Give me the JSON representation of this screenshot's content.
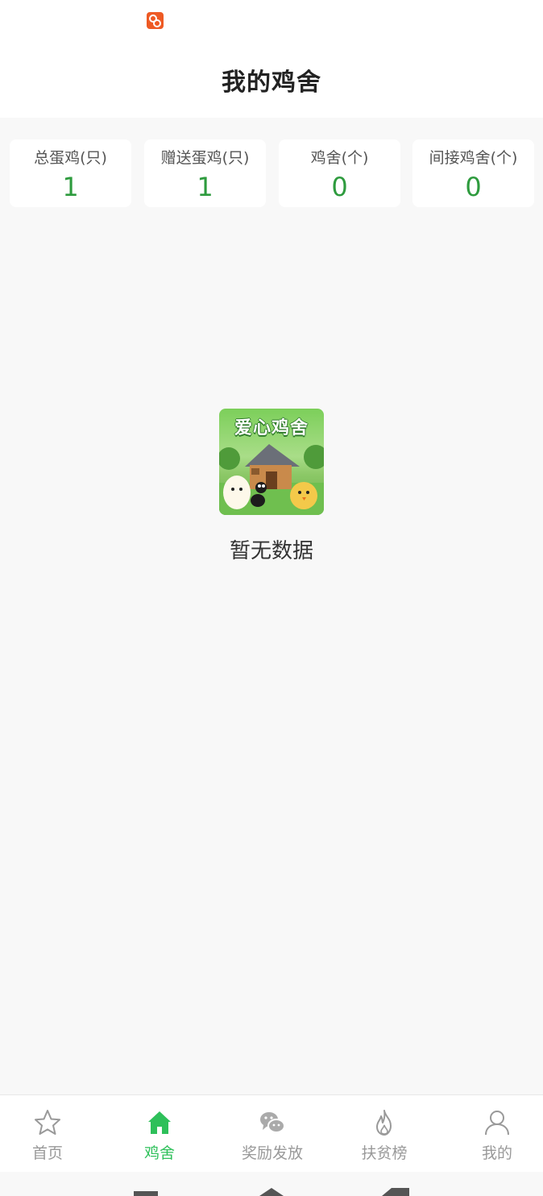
{
  "header": {
    "title": "我的鸡舍"
  },
  "stats": [
    {
      "label": "总蛋鸡(只)",
      "value": "1"
    },
    {
      "label": "赠送蛋鸡(只)",
      "value": "1"
    },
    {
      "label": "鸡舍(个)",
      "value": "0"
    },
    {
      "label": "间接鸡舍(个)",
      "value": "0"
    }
  ],
  "empty": {
    "image_caption": "爱心鸡舍",
    "text": "暂无数据"
  },
  "tabbar": {
    "items": [
      {
        "label": "首页",
        "icon": "star-icon"
      },
      {
        "label": "鸡舍",
        "icon": "home-icon"
      },
      {
        "label": "奖励发放",
        "icon": "wechat-icon"
      },
      {
        "label": "扶贫榜",
        "icon": "fire-icon"
      },
      {
        "label": "我的",
        "icon": "user-icon"
      }
    ],
    "active_index": 1
  },
  "colors": {
    "accent": "#2ec05a",
    "stat_value": "#2e9b3e",
    "inactive": "#999999"
  }
}
